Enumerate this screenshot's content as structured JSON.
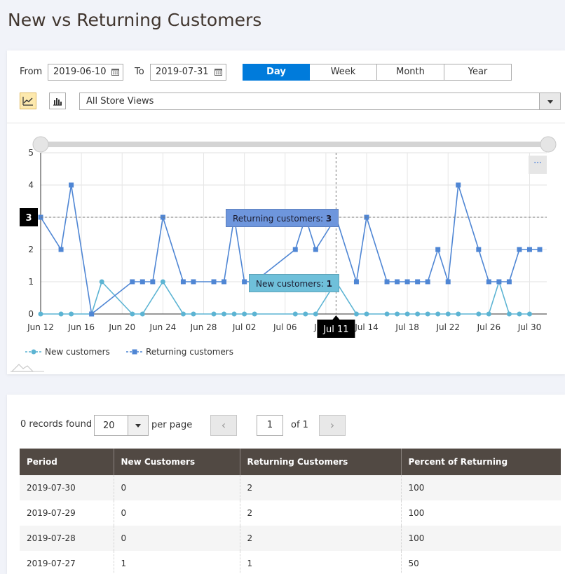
{
  "page": {
    "title": "New vs Returning Customers"
  },
  "filters": {
    "from_label": "From",
    "from_value": "2019-06-10",
    "to_label": "To",
    "to_value": "2019-07-31",
    "period_tabs": [
      {
        "label": "Day",
        "active": true
      },
      {
        "label": "Week",
        "active": false
      },
      {
        "label": "Month",
        "active": false
      },
      {
        "label": "Year",
        "active": false
      }
    ],
    "store_view": "All Store Views"
  },
  "chart_controls": {
    "more_label": "···"
  },
  "tooltips": {
    "returning_label": "Returning customers: ",
    "returning_value": "3",
    "new_label": "New customers: ",
    "new_value": "1",
    "crosshair_y": "3",
    "crosshair_x": "Jul 11"
  },
  "chart_data": {
    "type": "line",
    "x_tick_labels": [
      "Jun 12",
      "Jun 16",
      "Jun 20",
      "Jun 24",
      "Jun 28",
      "Jul 02",
      "Jul 06",
      "Jul 10",
      "Jul 14",
      "Jul 18",
      "Jul 22",
      "Jul 26",
      "Jul 30"
    ],
    "y_ticks": [
      0,
      1,
      2,
      3,
      4,
      5
    ],
    "ylim": [
      0,
      5
    ],
    "xlim": [
      "2019-06-12",
      "2019-07-31"
    ],
    "grid": true,
    "legend_position": "bottom-left",
    "series": [
      {
        "name": "New customers",
        "color": "#5cb4d3",
        "marker": "circle",
        "points": [
          [
            "2019-06-12",
            0
          ],
          [
            "2019-06-14",
            0
          ],
          [
            "2019-06-15",
            0
          ],
          [
            "2019-06-17",
            0
          ],
          [
            "2019-06-18",
            1
          ],
          [
            "2019-06-21",
            0
          ],
          [
            "2019-06-22",
            0
          ],
          [
            "2019-06-24",
            1
          ],
          [
            "2019-06-26",
            0
          ],
          [
            "2019-06-27",
            0
          ],
          [
            "2019-06-29",
            0
          ],
          [
            "2019-06-30",
            0
          ],
          [
            "2019-07-01",
            0
          ],
          [
            "2019-07-02",
            0
          ],
          [
            "2019-07-03",
            0
          ],
          [
            "2019-07-07",
            0
          ],
          [
            "2019-07-08",
            0
          ],
          [
            "2019-07-09",
            0
          ],
          [
            "2019-07-11",
            1
          ],
          [
            "2019-07-13",
            0
          ],
          [
            "2019-07-14",
            0
          ],
          [
            "2019-07-16",
            0
          ],
          [
            "2019-07-17",
            0
          ],
          [
            "2019-07-18",
            0
          ],
          [
            "2019-07-19",
            0
          ],
          [
            "2019-07-20",
            0
          ],
          [
            "2019-07-21",
            0
          ],
          [
            "2019-07-22",
            0
          ],
          [
            "2019-07-23",
            0
          ],
          [
            "2019-07-25",
            0
          ],
          [
            "2019-07-26",
            0
          ],
          [
            "2019-07-27",
            1
          ],
          [
            "2019-07-28",
            0
          ],
          [
            "2019-07-29",
            0
          ],
          [
            "2019-07-30",
            0
          ]
        ]
      },
      {
        "name": "Returning customers",
        "color": "#4f86d4",
        "marker": "square",
        "points": [
          [
            "2019-06-12",
            3
          ],
          [
            "2019-06-14",
            2
          ],
          [
            "2019-06-15",
            4
          ],
          [
            "2019-06-17",
            0
          ],
          [
            "2019-06-21",
            1
          ],
          [
            "2019-06-22",
            1
          ],
          [
            "2019-06-23",
            1
          ],
          [
            "2019-06-24",
            3
          ],
          [
            "2019-06-26",
            1
          ],
          [
            "2019-06-27",
            1
          ],
          [
            "2019-06-29",
            1
          ],
          [
            "2019-06-30",
            1
          ],
          [
            "2019-07-01",
            3
          ],
          [
            "2019-07-02",
            1
          ],
          [
            "2019-07-03",
            1
          ],
          [
            "2019-07-07",
            2
          ],
          [
            "2019-07-08",
            3
          ],
          [
            "2019-07-09",
            2
          ],
          [
            "2019-07-11",
            3
          ],
          [
            "2019-07-13",
            1
          ],
          [
            "2019-07-14",
            3
          ],
          [
            "2019-07-16",
            1
          ],
          [
            "2019-07-17",
            1
          ],
          [
            "2019-07-18",
            1
          ],
          [
            "2019-07-19",
            1
          ],
          [
            "2019-07-20",
            1
          ],
          [
            "2019-07-21",
            2
          ],
          [
            "2019-07-22",
            1
          ],
          [
            "2019-07-23",
            4
          ],
          [
            "2019-07-25",
            2
          ],
          [
            "2019-07-26",
            1
          ],
          [
            "2019-07-27",
            1
          ],
          [
            "2019-07-28",
            1
          ],
          [
            "2019-07-29",
            2
          ],
          [
            "2019-07-30",
            2
          ],
          [
            "2019-07-31",
            2
          ]
        ]
      }
    ]
  },
  "grid": {
    "records_found": "0 records found",
    "per_page_value": "20",
    "per_page_label": "per page",
    "page_current": "1",
    "page_of": "of 1",
    "columns": [
      "Period",
      "New Customers",
      "Returning Customers",
      "Percent of Returning"
    ],
    "rows": [
      [
        "2019-07-30",
        "0",
        "2",
        "100"
      ],
      [
        "2019-07-29",
        "0",
        "2",
        "100"
      ],
      [
        "2019-07-28",
        "0",
        "2",
        "100"
      ],
      [
        "2019-07-27",
        "1",
        "1",
        "50"
      ]
    ]
  }
}
